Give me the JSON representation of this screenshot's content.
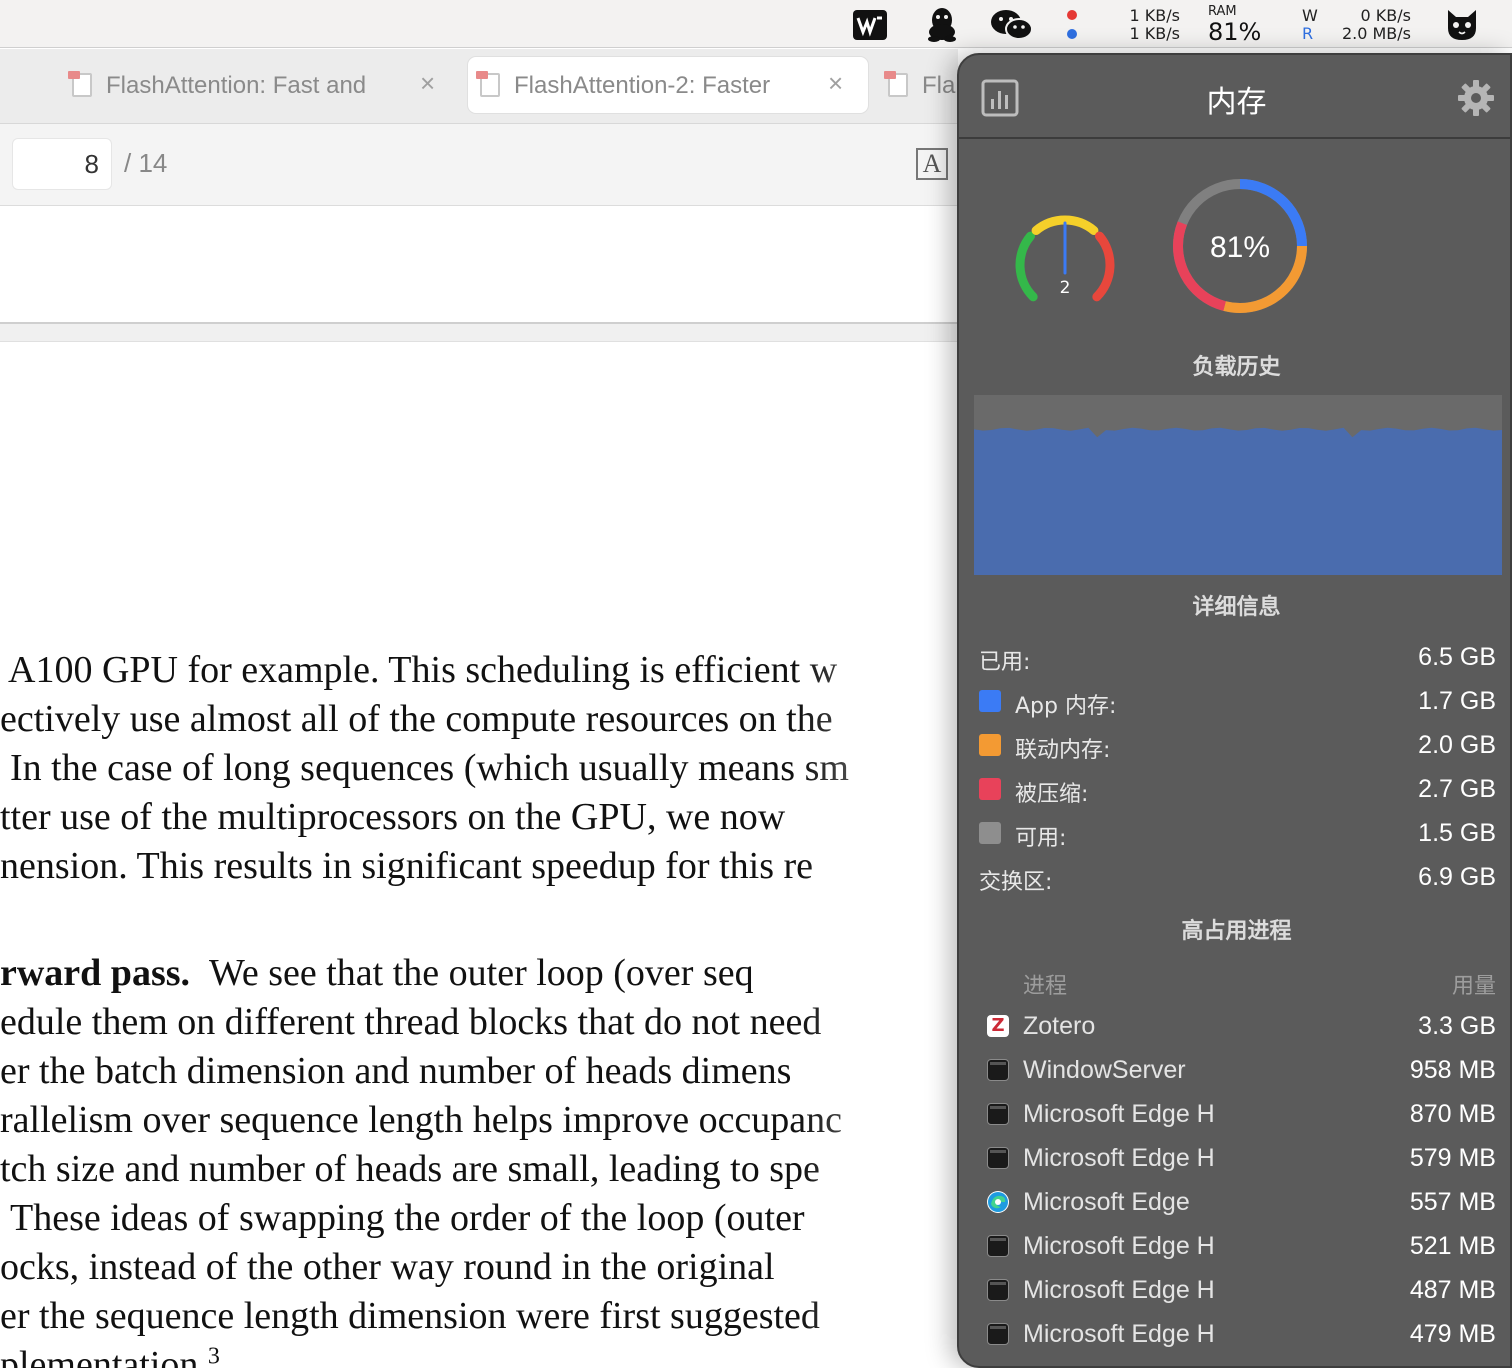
{
  "menubar": {
    "net_up": "1 KB/s",
    "net_down": "1 KB/s",
    "ram_label": "RAM",
    "ram_value": "81%",
    "disk_w_label": "W",
    "disk_r_label": "R",
    "disk_w_value": "0 KB/s",
    "disk_r_value": "2.0 MB/s",
    "icons": [
      "wps-office-icon",
      "qq-penguin-icon",
      "wechat-icon",
      "activity-dots-icon",
      "cat-avatar-icon"
    ]
  },
  "tabs": [
    {
      "title": "FlashAttention: Fast and ",
      "active": false
    },
    {
      "title": "FlashAttention-2: Faster ",
      "active": true
    },
    {
      "title": "Fla",
      "active": false
    }
  ],
  "toolbar": {
    "page_current": "8",
    "page_total": "/ 14"
  },
  "document": {
    "lines": [
      "A100 GPU for example.  This scheduling is efficient w",
      "ectively use almost all of the compute resources on the",
      "In the case of long sequences (which usually means sm",
      "tter use of the multiprocessors on the GPU, we now",
      "nension.  This results in significant speedup for this re",
      "",
      "edule them on different thread blocks that do not need",
      "er the batch dimension and number of heads dimens",
      "rallelism over sequence length helps improve occupanc",
      "tch size and number of heads are small, leading to spe",
      "These ideas of swapping the order of the loop (outer",
      "ocks, instead of the other way round in the original",
      "er the sequence length dimension were first suggested",
      "plementation."
    ],
    "bold_head": "rward pass.",
    "bold_tail": "We see that the outer loop (over seq",
    "footnote": "3"
  },
  "panel": {
    "title": "内存",
    "gauge_value": "2",
    "gauge_level": 0.5,
    "ring_label": "81%",
    "ring_usage": 0.81,
    "history_title": "负载历史",
    "history_level": 0.81,
    "details_title": "详细信息",
    "details": [
      {
        "label": "已用:",
        "value": "6.5 GB",
        "color": null
      },
      {
        "label": "App 内存:",
        "value": "1.7 GB",
        "color": "#3b7bf5"
      },
      {
        "label": "联动内存:",
        "value": "2.0 GB",
        "color": "#f39a33"
      },
      {
        "label": "被压缩:",
        "value": "2.7 GB",
        "color": "#e8425a"
      },
      {
        "label": "可用:",
        "value": "1.5 GB",
        "color": "#8e8e8e"
      },
      {
        "label": "交换区:",
        "value": "6.9 GB",
        "color": null
      }
    ],
    "processes_title": "高占用进程",
    "process_col_name": "进程",
    "process_col_usage": "用量",
    "processes": [
      {
        "name": "Zotero",
        "usage": "3.3 GB",
        "icon": "zotero-icon"
      },
      {
        "name": "WindowServer",
        "usage": "958 MB",
        "icon": "terminal-icon"
      },
      {
        "name": "Microsoft Edge H",
        "usage": "870 MB",
        "icon": "terminal-icon"
      },
      {
        "name": "Microsoft Edge H",
        "usage": "579 MB",
        "icon": "terminal-icon"
      },
      {
        "name": "Microsoft Edge",
        "usage": "557 MB",
        "icon": "edge-icon"
      },
      {
        "name": "Microsoft Edge H",
        "usage": "521 MB",
        "icon": "terminal-icon"
      },
      {
        "name": "Microsoft Edge H",
        "usage": "487 MB",
        "icon": "terminal-icon"
      },
      {
        "name": "Microsoft Edge H",
        "usage": "479 MB",
        "icon": "terminal-icon"
      }
    ],
    "colors": {
      "blue": "#3b7bf5",
      "orange": "#f39a33",
      "red": "#e8425a",
      "gray": "#8e8e8e",
      "history_fill": "#4a6cae"
    }
  }
}
